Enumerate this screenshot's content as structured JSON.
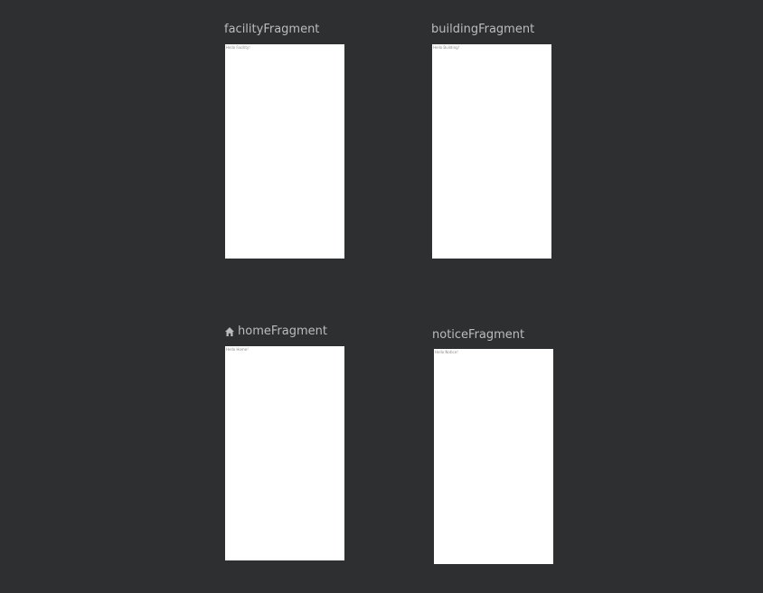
{
  "fragments": {
    "facility": {
      "title": "facilityFragment",
      "preview_text": "Hello Facility!"
    },
    "building": {
      "title": "buildingFragment",
      "preview_text": "Hello Building!"
    },
    "home": {
      "title": "homeFragment",
      "preview_text": "Hello Home!",
      "start_destination_icon": "home-icon"
    },
    "notice": {
      "title": "noticeFragment",
      "preview_text": "Hello Notice!"
    }
  },
  "colors": {
    "canvas_background": "#2e2f31",
    "title_text": "#bcbcbc",
    "preview_background": "#ffffff"
  }
}
